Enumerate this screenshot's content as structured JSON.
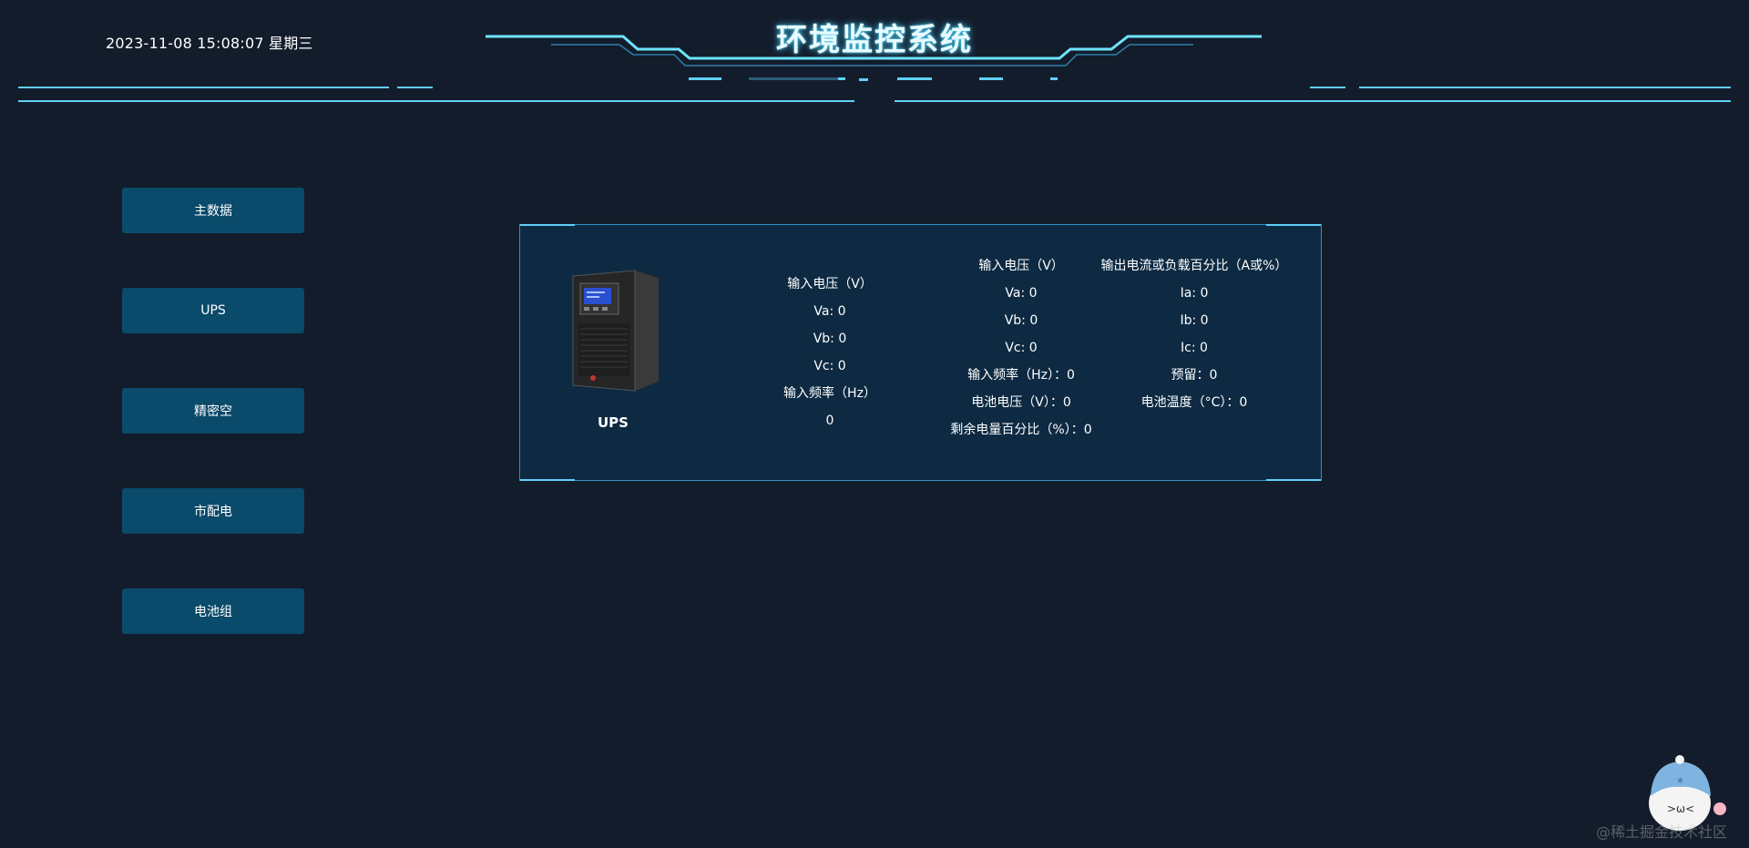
{
  "header": {
    "datetime": "2023-11-08 15:08:07 星期三",
    "title": "环境监控系统"
  },
  "sidebar": {
    "items": [
      {
        "label": "主数据"
      },
      {
        "label": "UPS"
      },
      {
        "label": "精密空"
      },
      {
        "label": "市配电"
      },
      {
        "label": "电池组"
      }
    ]
  },
  "ups_card": {
    "device_label": "UPS",
    "col1": {
      "title": "输入电压（V）",
      "va": "Va: 0",
      "vb": "Vb: 0",
      "vc": "Vc: 0",
      "freq_title": "输入频率（Hz）",
      "freq_value": "0"
    },
    "col2": {
      "title": "输入电压（V）",
      "va": "Va: 0",
      "vb": "Vb: 0",
      "vc": "Vc: 0",
      "freq": "输入频率（Hz）：0",
      "battery_voltage": "电池电压（V）：0",
      "remaining": "剩余电量百分比（%）：0"
    },
    "col3": {
      "title": "输出电流或负载百分比（A或%）",
      "ia": "Ia: 0",
      "ib": "Ib: 0",
      "ic": "Ic: 0",
      "reserved": "预留：0",
      "battery_temp": "电池温度（°C）：0"
    }
  },
  "watermark": {
    "text": "@稀土掘金技术社区"
  },
  "colors": {
    "background": "#131c2b",
    "accent": "#5fd0f5",
    "button": "#0a4a6a",
    "card": "#0d2a42"
  }
}
